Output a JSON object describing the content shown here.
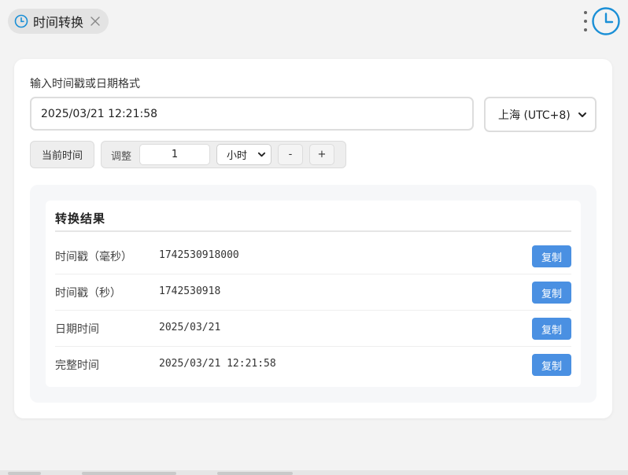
{
  "tab": {
    "title": "时间转换",
    "icon": "clock-icon",
    "close_icon": "close-icon"
  },
  "toolbar": {
    "menu_icon": "more-vertical-icon",
    "app_icon": "clock-icon"
  },
  "form": {
    "input_label": "输入时间戳或日期格式",
    "datetime_value": "2025/03/21 12:21:58",
    "timezone_selected": "上海 (UTC+8)",
    "now_button": "当前时间",
    "adjust_label": "调整",
    "adjust_amount": "1",
    "adjust_unit": "小时",
    "decrement_label": "-",
    "increment_label": "+"
  },
  "results": {
    "title": "转换结果",
    "rows": [
      {
        "label": "时间戳（毫秒）",
        "value": "1742530918000",
        "copy": "复制"
      },
      {
        "label": "时间戳（秒）",
        "value": "1742530918",
        "copy": "复制"
      },
      {
        "label": "日期时间",
        "value": "2025/03/21",
        "copy": "复制"
      },
      {
        "label": "完整时间",
        "value": "2025/03/21 12:21:58",
        "copy": "复制"
      }
    ]
  },
  "colors": {
    "accent": "#4a90e2",
    "clock_icon": "#1a8fd6",
    "background": "#f3f3f3"
  }
}
